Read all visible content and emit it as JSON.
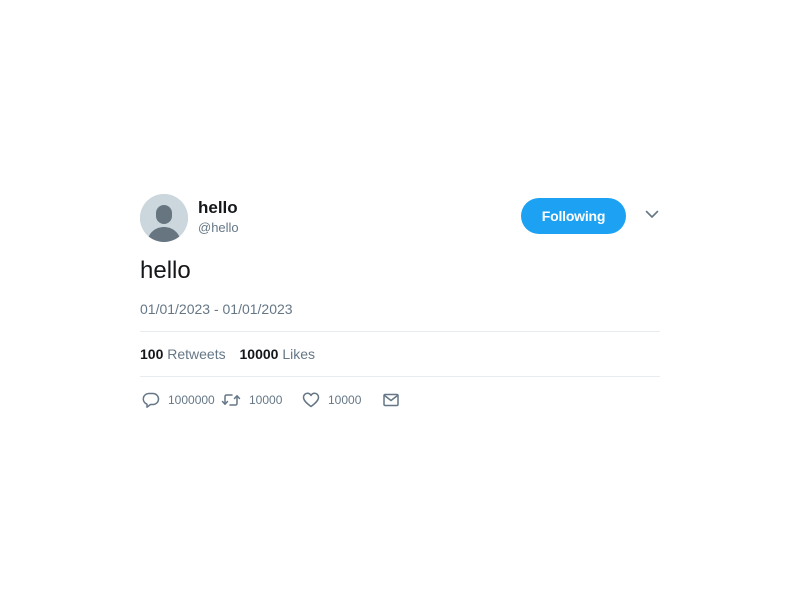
{
  "tweet": {
    "user": {
      "display_name": "hello",
      "handle": "@hello",
      "avatar_icon": "default-avatar-icon"
    },
    "follow_button_label": "Following",
    "caret_icon": "chevron-down-icon",
    "text": "hello",
    "date": "01/01/2023 - 01/01/2023",
    "stats": {
      "retweets_count": "100",
      "retweets_label": "Retweets",
      "likes_count": "10000",
      "likes_label": "Likes"
    },
    "actions": {
      "reply": {
        "icon": "reply-icon",
        "count": "1000000"
      },
      "retweet": {
        "icon": "retweet-icon",
        "count": "10000"
      },
      "like": {
        "icon": "heart-icon",
        "count": "10000"
      },
      "dm": {
        "icon": "envelope-icon"
      }
    }
  },
  "colors": {
    "accent": "#1da1f2",
    "text_primary": "#14171a",
    "text_secondary": "#657786",
    "divider": "#e6ecf0",
    "avatar_bg": "#ccd6dd",
    "avatar_fg": "#66757f"
  }
}
